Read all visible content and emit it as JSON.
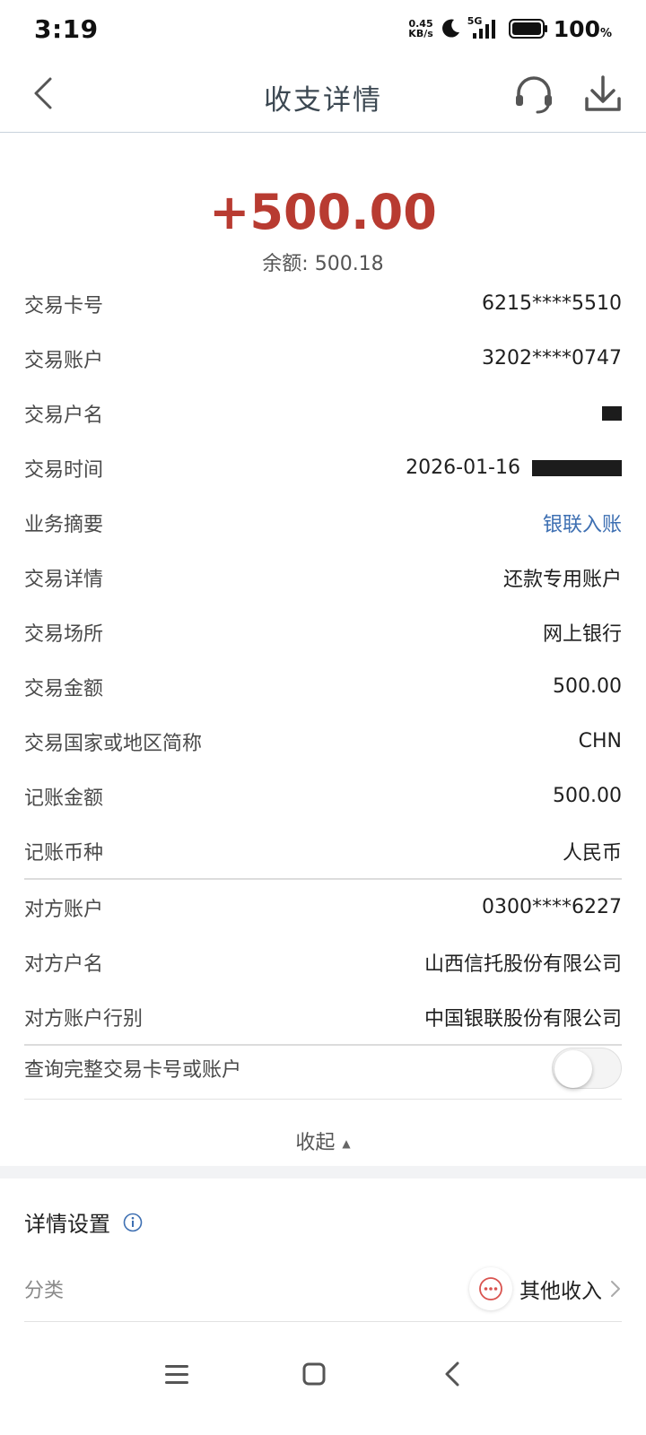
{
  "status_bar": {
    "time": "3:19",
    "net_speed_value": "0.45",
    "net_speed_unit": "KB/s",
    "network": "5G",
    "battery": "100",
    "battery_unit": "%"
  },
  "header": {
    "title": "收支详情",
    "icons": [
      "back-icon",
      "headset-icon",
      "download-icon"
    ]
  },
  "summary": {
    "amount": "+500.00",
    "balance": "余额: 500.18",
    "amount_color": "#b83b31"
  },
  "details": [
    {
      "label": "交易卡号",
      "value": "6215****5510"
    },
    {
      "label": "交易账户",
      "value": "3202****0747"
    },
    {
      "label": "交易户名",
      "value": ""
    },
    {
      "label": "交易时间",
      "value": "2026-01-16"
    },
    {
      "label": "业务摘要",
      "value": "银联入账"
    },
    {
      "label": "交易详情",
      "value": "还款专用账户"
    },
    {
      "label": "交易场所",
      "value": "网上银行"
    },
    {
      "label": "交易金额",
      "value": "500.00"
    },
    {
      "label": "交易国家或地区简称",
      "value": "CHN"
    },
    {
      "label": "记账金额",
      "value": "500.00"
    },
    {
      "label": "记账币种",
      "value": "人民币"
    },
    {
      "label": "对方账户",
      "value": "0300****6227"
    },
    {
      "label": "对方户名",
      "value": "山西信托股份有限公司"
    },
    {
      "label": "对方账户行别",
      "value": "中国银联股份有限公司"
    }
  ],
  "toggle": {
    "label": "查询完整交易卡号或账户",
    "state": "off"
  },
  "collapse_label": "收起",
  "settings": {
    "title": "详情设置",
    "category_label": "分类",
    "category_value": "其他收入"
  },
  "link_color": "#3d6fb2"
}
